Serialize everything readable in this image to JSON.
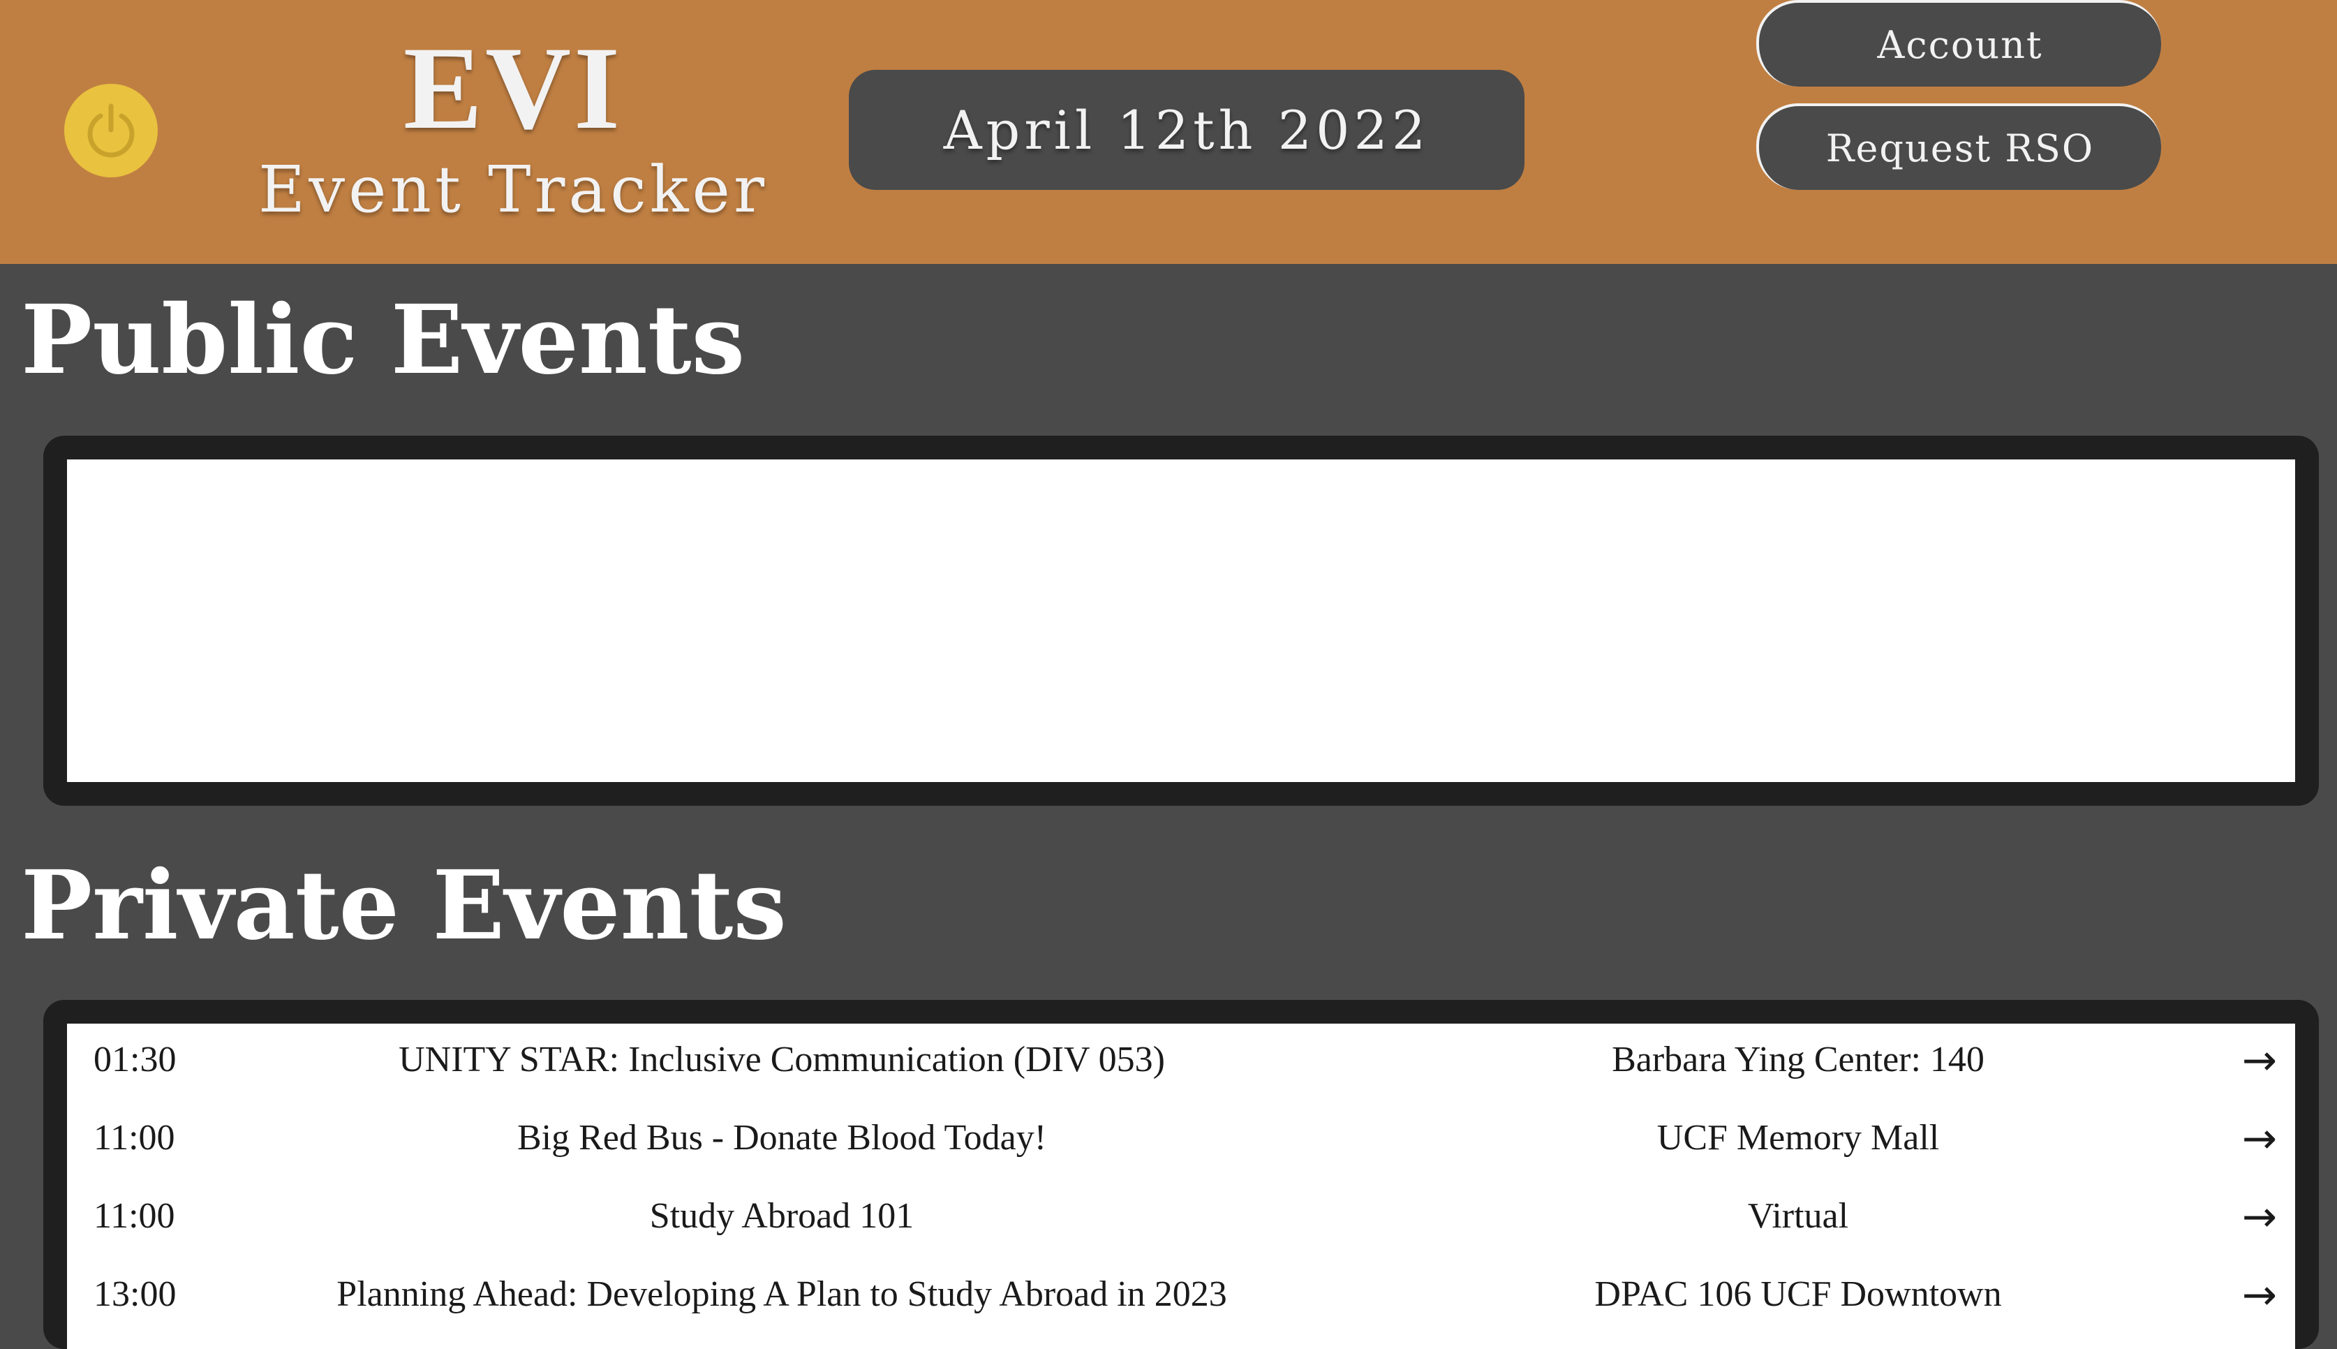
{
  "header": {
    "brand_title": "EVI",
    "brand_subtitle": "Event Tracker",
    "date": "April 12th 2022",
    "account_label": "Account",
    "request_rso_label": "Request RSO",
    "power_icon": "power-icon"
  },
  "colors": {
    "header_bg": "#c07f42",
    "page_bg": "#4a4a4a",
    "power_button": "#e9c23f",
    "panel_border": "#1f1f1f"
  },
  "public_events": {
    "title": "Public Events",
    "rows": []
  },
  "private_events": {
    "title": "Private Events",
    "rows": [
      {
        "time": "01:30",
        "title": "UNITY STAR: Inclusive Communication (DIV 053)",
        "location": "Barbara Ying Center: 140",
        "arrow": "→"
      },
      {
        "time": "11:00",
        "title": "Big Red Bus - Donate Blood Today!",
        "location": "UCF Memory Mall",
        "arrow": "→"
      },
      {
        "time": "11:00",
        "title": "Study Abroad 101",
        "location": "Virtual",
        "arrow": "→"
      },
      {
        "time": "13:00",
        "title": "Planning Ahead: Developing A Plan to Study Abroad in 2023",
        "location": "DPAC 106 UCF Downtown",
        "arrow": "→"
      }
    ]
  }
}
